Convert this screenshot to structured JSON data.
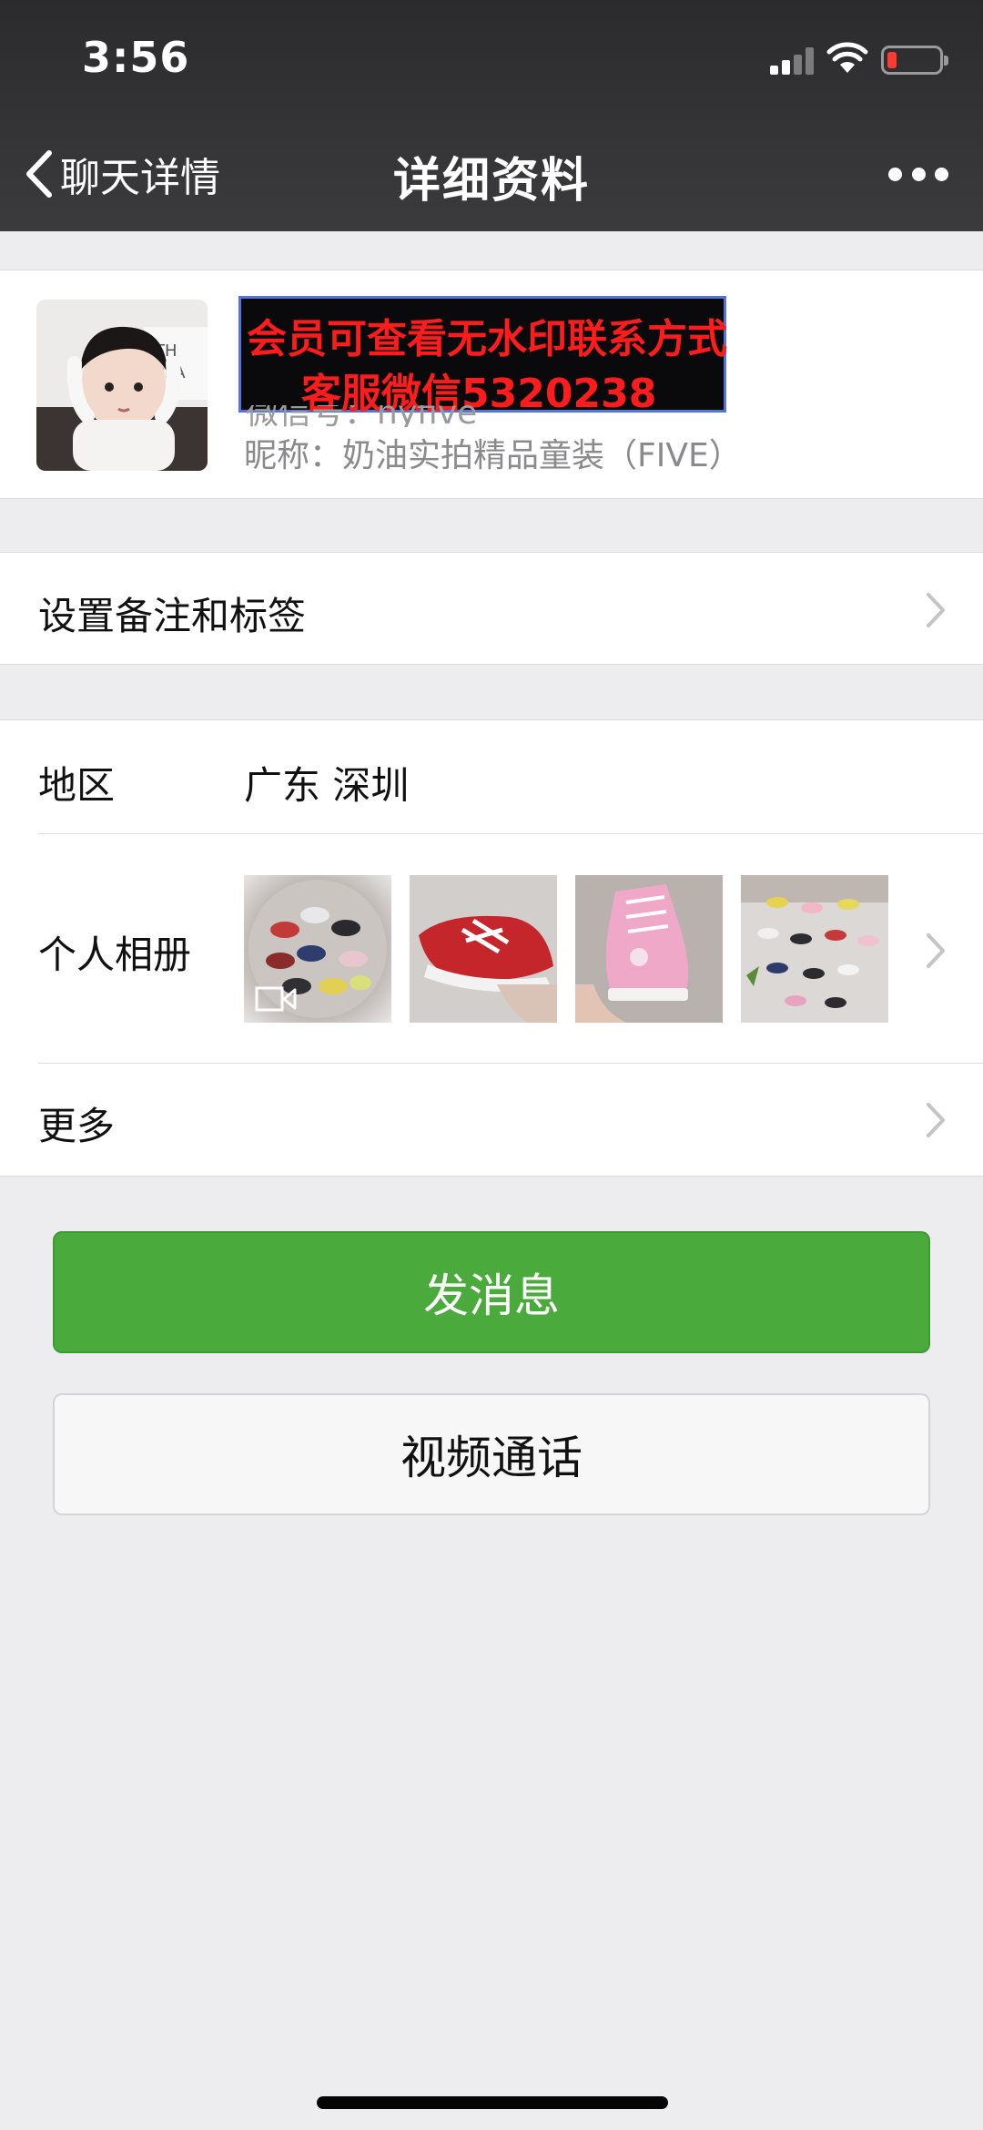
{
  "status_bar": {
    "time": "3:56",
    "signal_bars_active": 2,
    "signal_bars_total": 4,
    "battery_color": "#ff3b30"
  },
  "nav": {
    "back_label": "聊天详情",
    "title": "详细资料",
    "more_icon": "more-dots-icon"
  },
  "profile": {
    "watermark_line1": "会员可查看无水印联系方式",
    "watermark_line2": "客服微信5320238",
    "wechat_id_partial": "微信号：hyfive",
    "nickname": "昵称：奶油实拍精品童装（FIVE）"
  },
  "remark_row": {
    "label": "设置备注和标签"
  },
  "info": {
    "region_label": "地区",
    "region_value": "广东  深圳",
    "album_label": "个人相册",
    "more_label": "更多"
  },
  "buttons": {
    "send_message": "发消息",
    "video_call": "视频通话"
  },
  "colors": {
    "primary_green": "#4aab3c",
    "nav_bg": "#2b2b2d",
    "page_bg": "#ededf0"
  }
}
